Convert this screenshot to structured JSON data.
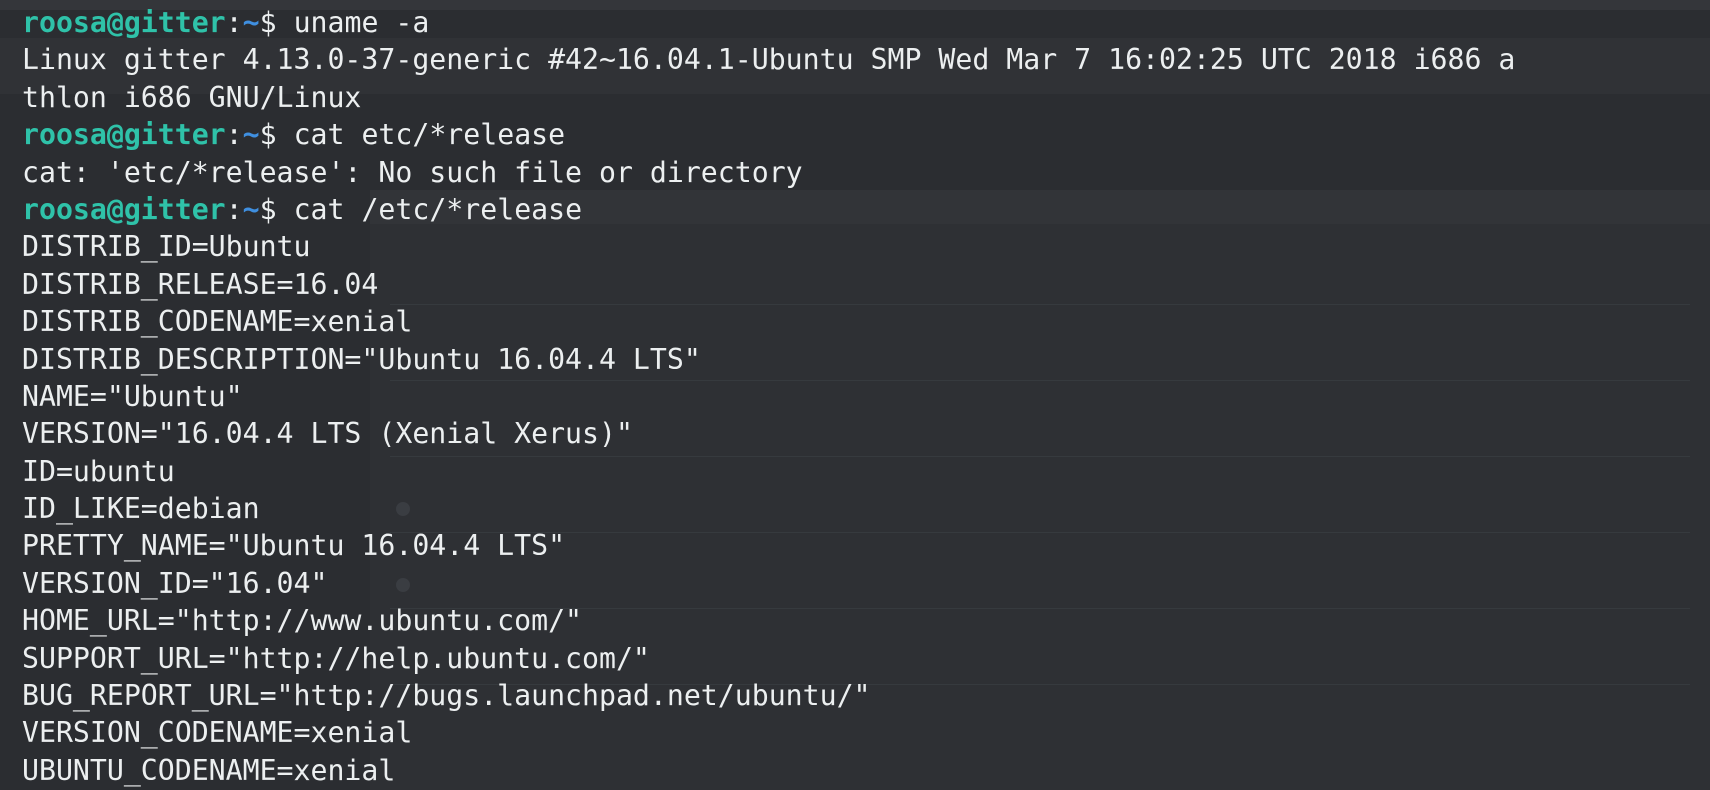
{
  "terminal": {
    "lines": [
      {
        "type": "prompt",
        "user": "roosa@gitter",
        "sep": ":",
        "path": "~",
        "symbol": "$",
        "command": " uname -a"
      },
      {
        "type": "output",
        "text": "Linux gitter 4.13.0-37-generic #42~16.04.1-Ubuntu SMP Wed Mar 7 16:02:25 UTC 2018 i686 a"
      },
      {
        "type": "output",
        "text": "thlon i686 GNU/Linux"
      },
      {
        "type": "prompt",
        "user": "roosa@gitter",
        "sep": ":",
        "path": "~",
        "symbol": "$",
        "command": " cat etc/*release"
      },
      {
        "type": "output",
        "text": "cat: 'etc/*release': No such file or directory"
      },
      {
        "type": "prompt",
        "user": "roosa@gitter",
        "sep": ":",
        "path": "~",
        "symbol": "$",
        "command": " cat /etc/*release"
      },
      {
        "type": "output",
        "text": "DISTRIB_ID=Ubuntu"
      },
      {
        "type": "output",
        "text": "DISTRIB_RELEASE=16.04"
      },
      {
        "type": "output",
        "text": "DISTRIB_CODENAME=xenial"
      },
      {
        "type": "output",
        "text": "DISTRIB_DESCRIPTION=\"Ubuntu 16.04.4 LTS\""
      },
      {
        "type": "output",
        "text": "NAME=\"Ubuntu\""
      },
      {
        "type": "output",
        "text": "VERSION=\"16.04.4 LTS (Xenial Xerus)\""
      },
      {
        "type": "output",
        "text": "ID=ubuntu"
      },
      {
        "type": "output",
        "text": "ID_LIKE=debian"
      },
      {
        "type": "output",
        "text": "PRETTY_NAME=\"Ubuntu 16.04.4 LTS\""
      },
      {
        "type": "output",
        "text": "VERSION_ID=\"16.04\""
      },
      {
        "type": "output",
        "text": "HOME_URL=\"http://www.ubuntu.com/\""
      },
      {
        "type": "output",
        "text": "SUPPORT_URL=\"http://help.ubuntu.com/\""
      },
      {
        "type": "output",
        "text": "BUG_REPORT_URL=\"http://bugs.launchpad.net/ubuntu/\""
      },
      {
        "type": "output",
        "text": "VERSION_CODENAME=xenial"
      },
      {
        "type": "output",
        "text": "UBUNTU_CODENAME=xenial"
      }
    ]
  },
  "colors": {
    "background": "#2b2d31",
    "text": "#eceff0",
    "prompt_user": "#2fc2a9",
    "prompt_path": "#3f8fe0"
  }
}
